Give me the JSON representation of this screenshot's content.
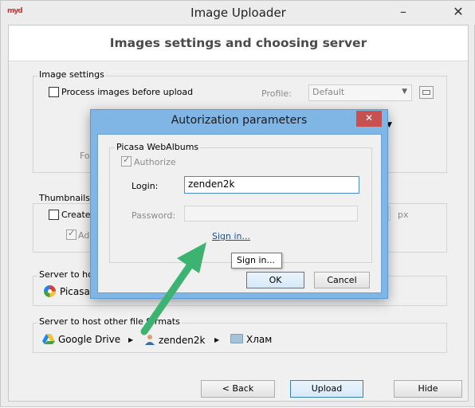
{
  "window": {
    "title": "Image Uploader",
    "header": "Images settings and choosing server",
    "app_icon": "myd"
  },
  "image_settings": {
    "label": "Image settings",
    "process_label": "Process images before upload",
    "profile_label": "Profile:",
    "profile_value": "Default",
    "hidden_label_fragment": "Fo"
  },
  "thumbnails": {
    "label": "Thumbnails",
    "create_label": "Create",
    "add_label": "Add",
    "unit": "px"
  },
  "server_images": {
    "label": "Server to host",
    "server_fragment": "Picasa W"
  },
  "server_files": {
    "label": "Server to host other file formats",
    "breadcrumb": [
      "Google Drive",
      "zenden2k",
      "Хлам"
    ]
  },
  "buttons": {
    "back": "< Back",
    "upload": "Upload",
    "hide": "Hide"
  },
  "dialog": {
    "title": "Autorization parameters",
    "close": "✕",
    "group_label": "Picasa WebAlbums",
    "authorize_label": "Authorize",
    "login_label": "Login:",
    "login_value": "zenden2k",
    "password_label": "Password:",
    "password_value": "",
    "sign_in_link": "Sign in...",
    "ok": "OK",
    "cancel": "Cancel"
  },
  "tooltip": {
    "text": "Sign in..."
  },
  "colors": {
    "dialog_frame": "#7fb6e6",
    "close_button": "#c75050",
    "arrow": "#3cb371",
    "link": "#1a4fa0"
  }
}
